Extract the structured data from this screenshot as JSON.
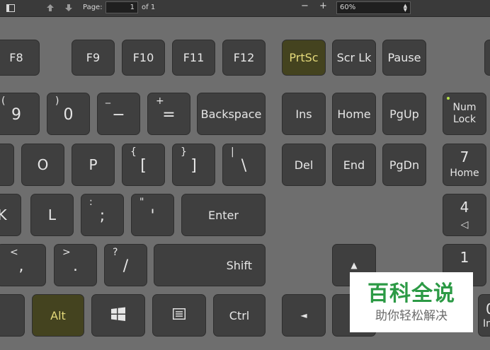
{
  "toolbar": {
    "page_label": "Page:",
    "page_value": "1",
    "page_total": "of 1",
    "zoom_out": "−",
    "zoom_in": "+",
    "zoom_value": "60%"
  },
  "keys": {
    "f8": "F8",
    "f9": "F9",
    "f10": "F10",
    "f11": "F11",
    "f12": "F12",
    "prtsc": "PrtSc",
    "scrlk": "Scr Lk",
    "pause": "Pause",
    "k9_sym": "(",
    "k9": "9",
    "k0_sym": ")",
    "k0": "0",
    "minus_sym": "_",
    "minus": "−",
    "equals_sym": "+",
    "equals": "=",
    "backspace": "Backspace",
    "ins": "Ins",
    "home": "Home",
    "pgup": "PgUp",
    "numlock": "Num Lock",
    "o": "O",
    "p": "P",
    "lbracket_sym": "{",
    "lbracket": "[",
    "rbracket_sym": "}",
    "rbracket": "]",
    "backslash_sym": "|",
    "backslash": "\\",
    "del": "Del",
    "end": "End",
    "pgdn": "PgDn",
    "num7": "7",
    "num7_sub": "Home",
    "k": "K",
    "l": "L",
    "semicolon_sym": ":",
    "semicolon": ";",
    "quote_sym": "\"",
    "quote": "'",
    "enter": "Enter",
    "num4": "4",
    "num4_sub": "◁",
    "comma_sym": "<",
    "comma": ",",
    "period_sym": ">",
    "period": ".",
    "slash_sym": "?",
    "slash": "/",
    "shift": "Shift",
    "up_arrow": "▲",
    "num1": "1",
    "alt": "Alt",
    "ctrl": "Ctrl",
    "left_arrow": "◄",
    "num0": "0",
    "num0_sub": "In"
  },
  "watermark": {
    "title": "百科全说",
    "subtitle": "助你轻松解决"
  },
  "colors": {
    "background": "#6e6e6e",
    "key": "#3f3f3f",
    "key_highlight": "#44431f",
    "highlight_text": "#e4d97a",
    "numlock_led": "#b7e24a",
    "watermark_green": "#2c9a45"
  }
}
